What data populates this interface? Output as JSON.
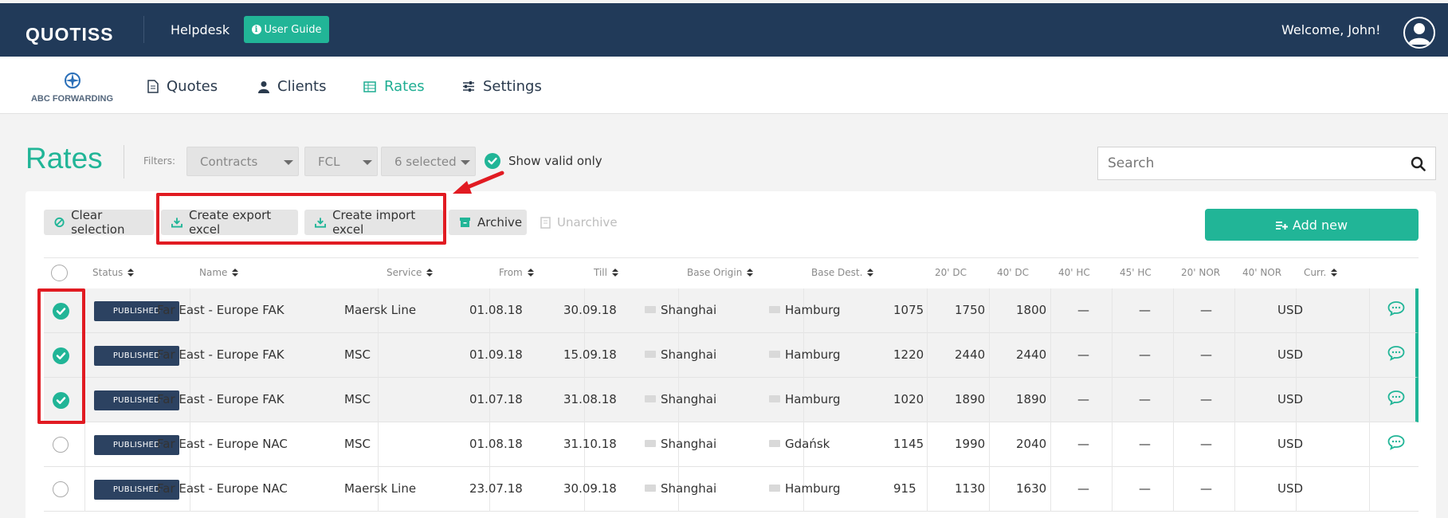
{
  "topbar": {
    "logo": "QUOTISS",
    "helpdesk": "Helpdesk",
    "user_guide": "User Guide",
    "welcome": "Welcome, John!"
  },
  "nav": {
    "company": "ABC FORWARDING",
    "items": [
      {
        "label": "Quotes",
        "icon": "document-icon"
      },
      {
        "label": "Clients",
        "icon": "user-icon"
      },
      {
        "label": "Rates",
        "icon": "table-icon",
        "active": true
      },
      {
        "label": "Settings",
        "icon": "sliders-icon"
      }
    ]
  },
  "page": {
    "title": "Rates",
    "filters_label": "Filters:",
    "filters": [
      "Contracts",
      "FCL",
      "6 selected"
    ],
    "show_valid_only": "Show valid only",
    "show_valid_checked": true,
    "search_placeholder": "Search"
  },
  "toolbar": {
    "clear_selection": "Clear selection",
    "create_export": "Create export excel",
    "create_import": "Create import excel",
    "archive": "Archive",
    "unarchive": "Unarchive",
    "add_new": "Add new"
  },
  "colors": {
    "accent": "#21b597",
    "topbar": "#213a59",
    "highlight": "#e11b22"
  },
  "table": {
    "headers": [
      "Status",
      "Name",
      "Service",
      "From",
      "Till",
      "Base Origin",
      "Base Dest.",
      "20' DC",
      "40' DC",
      "40' HC",
      "45' HC",
      "20' NOR",
      "40' NOR",
      "Curr."
    ],
    "rows": [
      {
        "selected": true,
        "status": "PUBLISHED",
        "name": "Far East - Europe FAK",
        "service": "Maersk Line",
        "from": "01.08.18",
        "till": "30.09.18",
        "origin": "Shanghai",
        "dest": "Hamburg",
        "dc20": "1075",
        "dc40": "1750",
        "hc40": "1800",
        "hc45": "—",
        "nor20": "—",
        "nor40": "—",
        "curr": "USD",
        "comment": true
      },
      {
        "selected": true,
        "status": "PUBLISHED",
        "name": "Far East - Europe FAK",
        "service": "MSC",
        "from": "01.09.18",
        "till": "15.09.18",
        "origin": "Shanghai",
        "dest": "Hamburg",
        "dc20": "1220",
        "dc40": "2440",
        "hc40": "2440",
        "hc45": "—",
        "nor20": "—",
        "nor40": "—",
        "curr": "USD",
        "comment": true
      },
      {
        "selected": true,
        "status": "PUBLISHED",
        "name": "Far East - Europe FAK",
        "service": "MSC",
        "from": "01.07.18",
        "till": "31.08.18",
        "origin": "Shanghai",
        "dest": "Hamburg",
        "dc20": "1020",
        "dc40": "1890",
        "hc40": "1890",
        "hc45": "—",
        "nor20": "—",
        "nor40": "—",
        "curr": "USD",
        "comment": true
      },
      {
        "selected": false,
        "status": "PUBLISHED",
        "name": "Far East - Europe NAC",
        "service": "MSC",
        "from": "01.08.18",
        "till": "31.10.18",
        "origin": "Shanghai",
        "dest": "Gdańsk",
        "dc20": "1145",
        "dc40": "1990",
        "hc40": "2040",
        "hc45": "—",
        "nor20": "—",
        "nor40": "—",
        "curr": "USD",
        "comment": true
      },
      {
        "selected": false,
        "status": "PUBLISHED",
        "name": "Far East - Europe NAC",
        "service": "Maersk Line",
        "from": "23.07.18",
        "till": "30.09.18",
        "origin": "Shanghai",
        "dest": "Hamburg",
        "dc20": "915",
        "dc40": "1130",
        "hc40": "1630",
        "hc45": "—",
        "nor20": "—",
        "nor40": "—",
        "curr": "USD",
        "comment": false
      }
    ]
  }
}
